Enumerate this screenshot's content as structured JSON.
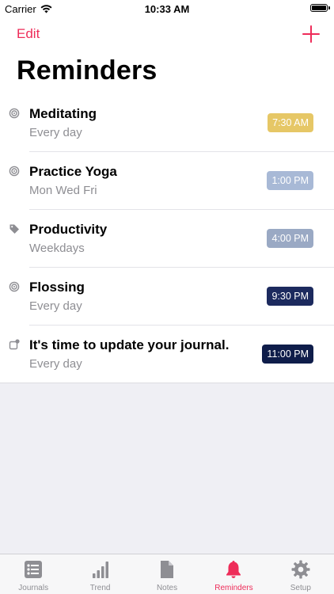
{
  "status": {
    "carrier": "Carrier",
    "time": "10:33 AM"
  },
  "nav": {
    "edit_label": "Edit",
    "title": "Reminders"
  },
  "reminders": [
    {
      "title": "Meditating",
      "schedule": "Every day",
      "time": "7:30 AM",
      "color": "#e6c766",
      "icon": "target-icon"
    },
    {
      "title": "Practice Yoga",
      "schedule": "Mon Wed Fri",
      "time": "1:00 PM",
      "color": "#a8b9d6",
      "icon": "target-icon"
    },
    {
      "title": "Productivity",
      "schedule": "Weekdays",
      "time": "4:00 PM",
      "color": "#9aa9c4",
      "icon": "tag-icon"
    },
    {
      "title": "Flossing",
      "schedule": "Every day",
      "time": "9:30 PM",
      "color": "#1c2a5e",
      "icon": "target-icon"
    },
    {
      "title": "It's time to update your journal.",
      "schedule": "Every day",
      "time": "11:00 PM",
      "color": "#0f1d4a",
      "icon": "journal-badge-icon"
    }
  ],
  "tabs": [
    {
      "label": "Journals",
      "icon": "journal-list-icon",
      "active": false
    },
    {
      "label": "Trend",
      "icon": "bar-chart-icon",
      "active": false
    },
    {
      "label": "Notes",
      "icon": "document-icon",
      "active": false
    },
    {
      "label": "Reminders",
      "icon": "bell-icon",
      "active": true
    },
    {
      "label": "Setup",
      "icon": "gear-icon",
      "active": false
    }
  ],
  "colors": {
    "accent": "#ee2c59",
    "inactive": "#8e8e93"
  }
}
